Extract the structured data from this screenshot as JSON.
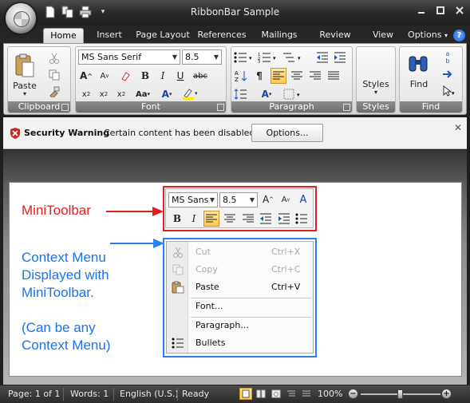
{
  "window": {
    "title": "RibbonBar Sample",
    "controls": [
      "minimize",
      "maximize",
      "close"
    ]
  },
  "quick_access": [
    "new-doc-icon",
    "copy-doc-icon",
    "print-icon",
    "customize-icon"
  ],
  "tabs": [
    {
      "label": "Home",
      "active": true
    },
    {
      "label": "Insert"
    },
    {
      "label": "Page Layout"
    },
    {
      "label": "References"
    },
    {
      "label": "Mailings"
    },
    {
      "label": "Review"
    },
    {
      "label": "View"
    }
  ],
  "options_tab": "Options",
  "help_label": "?",
  "ribbon": {
    "clipboard": {
      "label": "Clipboard",
      "paste": "Paste"
    },
    "font": {
      "label": "Font",
      "face": "MS Sans Serif",
      "size": "8.5"
    },
    "paragraph": {
      "label": "Paragraph"
    },
    "styles": {
      "label": "Styles",
      "button": "Styles"
    },
    "find": {
      "label": "Find",
      "button": "Find"
    }
  },
  "security": {
    "title": "Security Warning",
    "message": "Certain content has been disabled.",
    "button": "Options..."
  },
  "annotations": {
    "mini": "MiniToolbar",
    "ctx_lines": [
      "Context Menu",
      "Displayed with",
      "MiniToolbar.",
      "",
      "(Can be any",
      "Context Menu)"
    ]
  },
  "minitoolbar": {
    "font": "MS Sans",
    "size": "8.5"
  },
  "context_menu": [
    {
      "label": "Cut",
      "shortcut": "Ctrl+X",
      "icon": "scissors-icon",
      "disabled": true
    },
    {
      "label": "Copy",
      "shortcut": "Ctrl+C",
      "icon": "copy-icon",
      "disabled": true
    },
    {
      "label": "Paste",
      "shortcut": "Ctrl+V",
      "icon": "paste-icon",
      "disabled": false
    },
    {
      "label": "Font...",
      "shortcut": "",
      "icon": "",
      "disabled": false
    },
    {
      "label": "Paragraph...",
      "shortcut": "",
      "icon": "",
      "disabled": false
    },
    {
      "label": "Bullets",
      "shortcut": "",
      "icon": "bullets-icon",
      "disabled": false
    }
  ],
  "status": {
    "page": "Page: 1 of 1",
    "words": "Words: 1",
    "language": "English (U.S.)",
    "state": "Ready",
    "zoom": "100%",
    "zoom_value": 100
  }
}
